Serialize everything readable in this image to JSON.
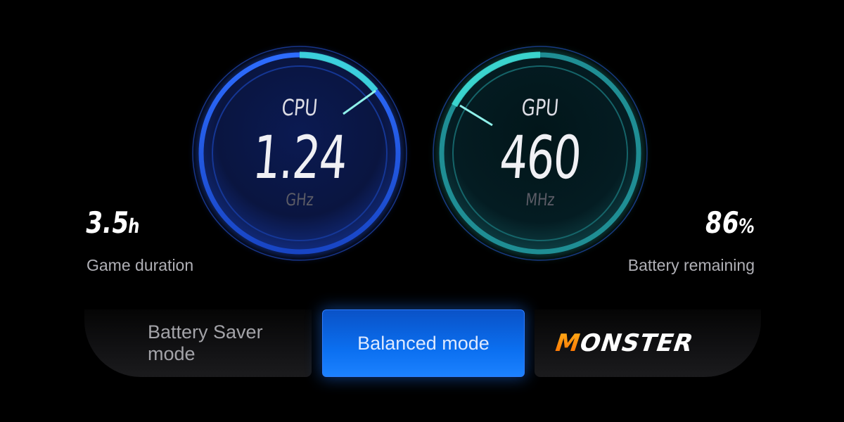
{
  "gauges": {
    "cpu": {
      "title": "CPU",
      "value": "1.24",
      "unit": "GHz",
      "accent": "#3fe0d8",
      "ring": "#1a5ad8"
    },
    "gpu": {
      "title": "GPU",
      "value": "460",
      "unit": "MHz",
      "accent": "#3fe0d8",
      "ring": "#21a4a4"
    }
  },
  "stats": {
    "game_duration": {
      "value": "3.5",
      "unit": "h",
      "label": "Game duration"
    },
    "battery": {
      "value": "86",
      "unit": "%",
      "label": "Battery remaining"
    }
  },
  "modes": {
    "saver_label": "Battery Saver mode",
    "balanced_label": "Balanced mode",
    "monster_logo": {
      "m": "M",
      "rest": "ONSTER"
    },
    "selected": "Balanced mode"
  },
  "colors": {
    "background": "#000000",
    "active_mode": "#0b6ff0",
    "monster_orange": "#ff7a00"
  }
}
